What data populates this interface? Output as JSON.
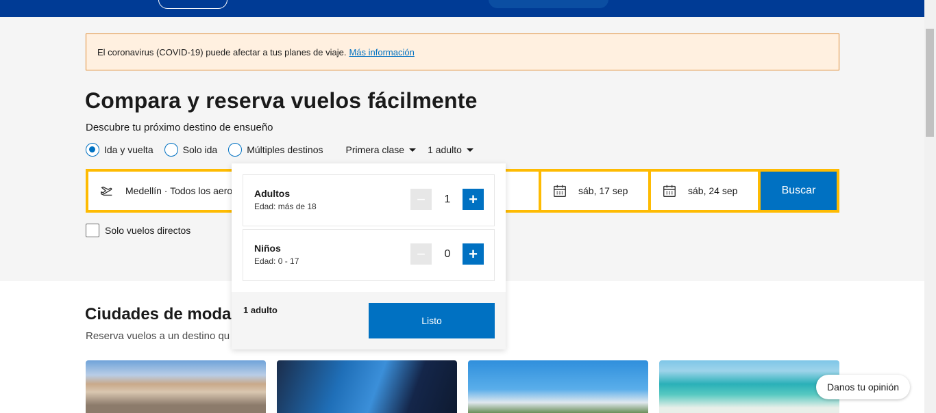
{
  "alert": {
    "text": "El coronavirus (COVID-19) puede afectar a tus planes de viaje.",
    "link": "Más información"
  },
  "hero": {
    "title": "Compara y reserva vuelos fácilmente",
    "subtitle": "Descubre tu próximo destino de ensueño"
  },
  "trip_types": [
    {
      "label": "Ida y vuelta",
      "selected": true
    },
    {
      "label": "Solo ida",
      "selected": false
    },
    {
      "label": "Múltiples destinos",
      "selected": false
    }
  ],
  "cabin_class": "Primera clase",
  "travelers": "1 adulto",
  "search": {
    "origin": "Medellín · Todos los aerop",
    "depart_date": "sáb, 17 sep",
    "return_date": "sáb, 24 sep",
    "button": "Buscar",
    "direct_only": "Solo vuelos directos"
  },
  "popup": {
    "adults": {
      "label": "Adultos",
      "sub": "Edad: más de 18",
      "value": "1"
    },
    "children": {
      "label": "Niños",
      "sub": "Edad: 0 - 17",
      "value": "0"
    },
    "minus": "−",
    "plus": "+",
    "summary": "1 adulto",
    "done": "Listo"
  },
  "trending": {
    "title": "Ciudades de moda",
    "subtitle": "Reserva vuelos a un destino qu"
  },
  "feedback": "Danos tu opinión",
  "colors": {
    "brand_dark": "#003b95",
    "accent_blue": "#0071c2",
    "search_border": "#febb02",
    "alert_bg": "#fff0e0"
  }
}
